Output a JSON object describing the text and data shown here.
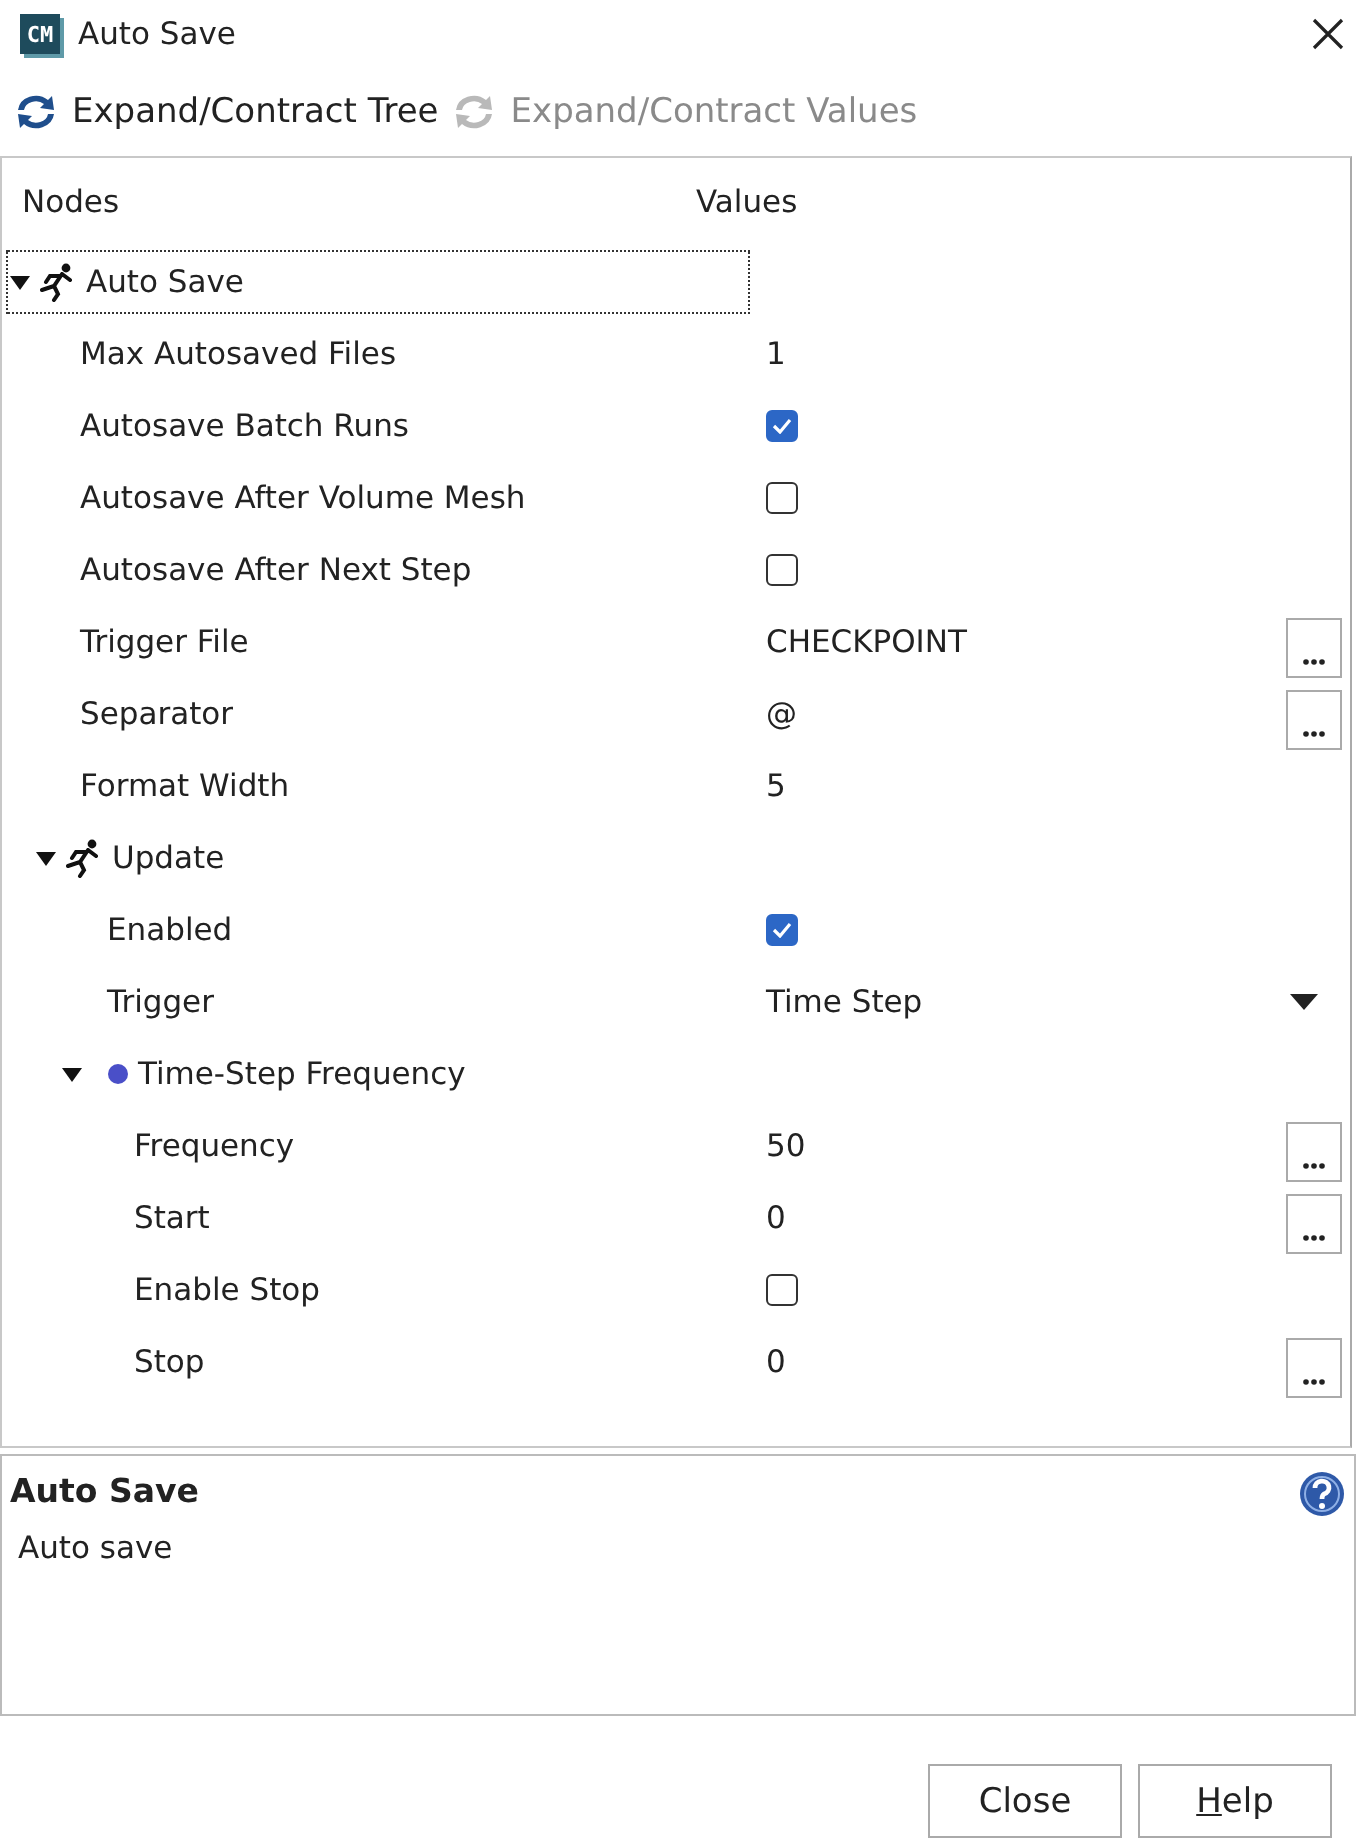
{
  "window": {
    "logo": "CM",
    "title": "Auto Save"
  },
  "toolbar": [
    {
      "label": "Expand/Contract Tree",
      "disabled": false
    },
    {
      "label": "Expand/Contract Values",
      "disabled": true
    }
  ],
  "tree": {
    "columns": [
      "Nodes",
      "Values"
    ],
    "nodes": [
      {
        "kind": "folder",
        "label": "Auto Save",
        "expanded": true,
        "focused": true,
        "children": [
          {
            "kind": "text_property",
            "label": "Max Autosaved Files",
            "value": "1",
            "focused": false
          },
          {
            "kind": "checkbox_property",
            "label": "Autosave Batch Runs",
            "checked": true,
            "focused": false
          },
          {
            "kind": "checkbox_property",
            "label": "Autosave After Volume Mesh",
            "checked": false,
            "focused": false
          },
          {
            "kind": "checkbox_property",
            "label": "Autosave After Next Step",
            "checked": false,
            "focused": false
          },
          {
            "kind": "button_property",
            "label": "Trigger File",
            "value": "CHECKPOINT",
            "focused": false
          },
          {
            "kind": "button_property",
            "label": "Separator",
            "value": "@",
            "focused": false
          },
          {
            "kind": "text_property",
            "label": "Format Width",
            "value": "5",
            "focused": false
          },
          {
            "kind": "folder",
            "label": "Update",
            "expanded": true,
            "focused": false,
            "children": [
              {
                "kind": "checkbox_property",
                "label": "Enabled",
                "checked": true,
                "focused": false
              },
              {
                "kind": "dropdown_property",
                "label": "Trigger",
                "value": "Time Step",
                "focused": false
              },
              {
                "kind": "group",
                "label": "Time-Step Frequency",
                "expanded": true,
                "focused": false,
                "children": [
                  {
                    "kind": "button_property",
                    "label": "Frequency",
                    "value": "50",
                    "focused": false
                  },
                  {
                    "kind": "button_property",
                    "label": "Start",
                    "value": "0",
                    "focused": false
                  },
                  {
                    "kind": "checkbox_property",
                    "label": "Enable Stop",
                    "checked": false,
                    "focused": false
                  },
                  {
                    "kind": "button_property",
                    "label": "Stop",
                    "value": "0",
                    "focused": false
                  }
                ]
              }
            ]
          }
        ]
      }
    ]
  },
  "description": {
    "title": "Auto Save",
    "text": "Auto save"
  },
  "buttons": [
    {
      "label": "Close",
      "mnemonic_underlined": false
    },
    {
      "label": "Help",
      "mnemonic_underlined": true
    }
  ]
}
